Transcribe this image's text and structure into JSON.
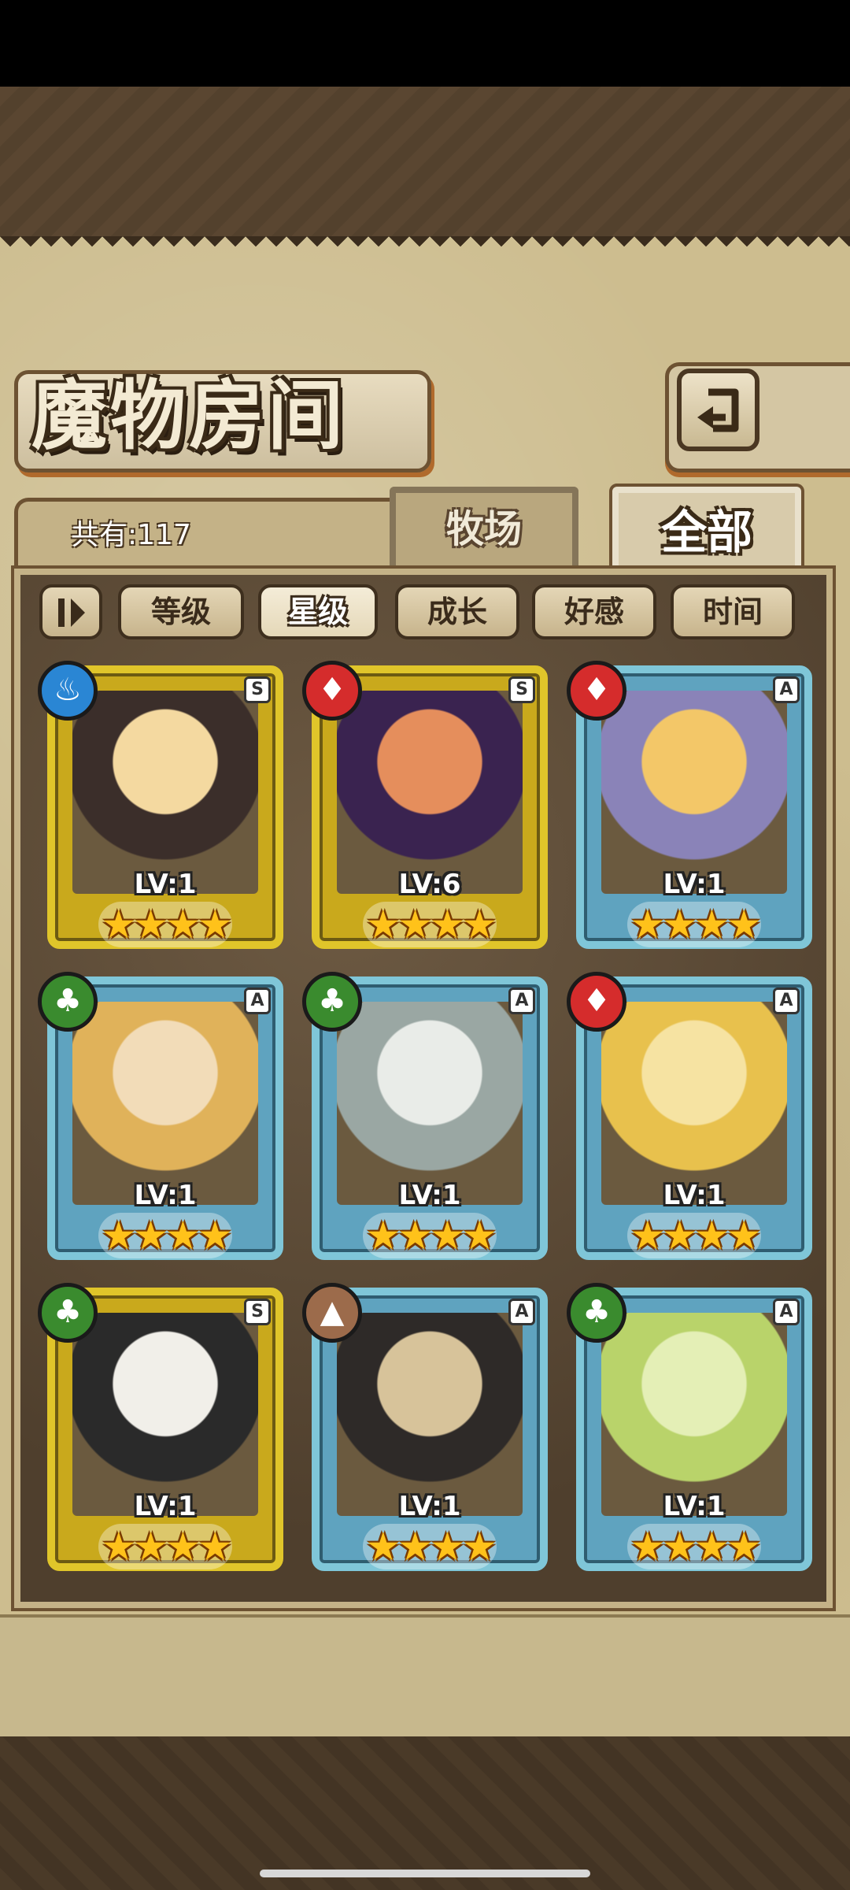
{
  "header": {
    "title": "魔物房间",
    "back_icon": "return-arrow-icon"
  },
  "tabs": {
    "count_label": "共有:117",
    "ranch_label": "牧场",
    "all_label": "全部",
    "active": "全部"
  },
  "filters": {
    "sort_icon": "sort-toggle-icon",
    "items": [
      "等级",
      "星级",
      "成长",
      "好感",
      "时间"
    ],
    "active": "星级"
  },
  "colors": {
    "s_frame": "#e0c52a",
    "a_frame": "#7fc6d8",
    "water": "#2a86d4",
    "fire": "#d52c2c",
    "leaf": "#3a8b2e",
    "earth": "#9c6b4b"
  },
  "monsters": [
    {
      "rank": "S",
      "element": "water-icon",
      "level": "LV:1",
      "stars": 4
    },
    {
      "rank": "S",
      "element": "fire-icon",
      "level": "LV:6",
      "stars": 4
    },
    {
      "rank": "A",
      "element": "fire-icon",
      "level": "LV:1",
      "stars": 4
    },
    {
      "rank": "A",
      "element": "leaf-icon",
      "level": "LV:1",
      "stars": 4
    },
    {
      "rank": "A",
      "element": "leaf-icon",
      "level": "LV:1",
      "stars": 4
    },
    {
      "rank": "A",
      "element": "fire-icon",
      "level": "LV:1",
      "stars": 4
    },
    {
      "rank": "S",
      "element": "leaf-icon",
      "level": "LV:1",
      "stars": 4
    },
    {
      "rank": "A",
      "element": "earth-icon",
      "level": "LV:1",
      "stars": 4
    },
    {
      "rank": "A",
      "element": "leaf-icon",
      "level": "LV:1",
      "stars": 4
    }
  ]
}
